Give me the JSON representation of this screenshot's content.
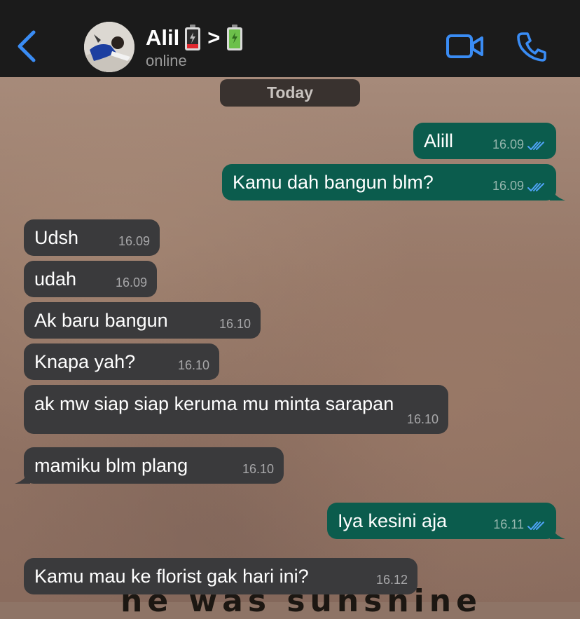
{
  "header": {
    "name": "Alil",
    "separator": ">",
    "status": "online",
    "icons": [
      "chevron-left-icon",
      "video-camera-icon",
      "phone-icon",
      "battery-low-icon",
      "battery-full-icon"
    ]
  },
  "day_label": "Today",
  "messages": [
    {
      "text": "Alill",
      "time": "16.09",
      "direction": "outgoing",
      "status": "read"
    },
    {
      "text": "Kamu dah bangun blm?",
      "time": "16.09",
      "direction": "outgoing",
      "status": "read"
    },
    {
      "text": "Udsh",
      "time": "16.09",
      "direction": "incoming"
    },
    {
      "text": "udah",
      "time": "16.09",
      "direction": "incoming"
    },
    {
      "text": "Ak baru bangun",
      "time": "16.10",
      "direction": "incoming"
    },
    {
      "text": "Knapa yah?",
      "time": "16.10",
      "direction": "incoming"
    },
    {
      "text": "ak mw siap siap keruma mu minta sarapan",
      "time": "16.10",
      "direction": "incoming"
    },
    {
      "text": "mamiku blm plang",
      "time": "16.10",
      "direction": "incoming"
    },
    {
      "text": "Iya kesini aja",
      "time": "16.11",
      "direction": "outgoing",
      "status": "read"
    },
    {
      "text": "Kamu mau ke florist gak hari ini?",
      "time": "16.12",
      "direction": "incoming"
    }
  ],
  "wallpaper_text": "he was sunshine",
  "colors": {
    "header_bg": "#1b1b1b",
    "accent_blue": "#3a8cf4",
    "incoming_bubble": "#3a3a3c",
    "outgoing_bubble": "#0b5c4d",
    "read_ticks": "#4fa3f7"
  }
}
